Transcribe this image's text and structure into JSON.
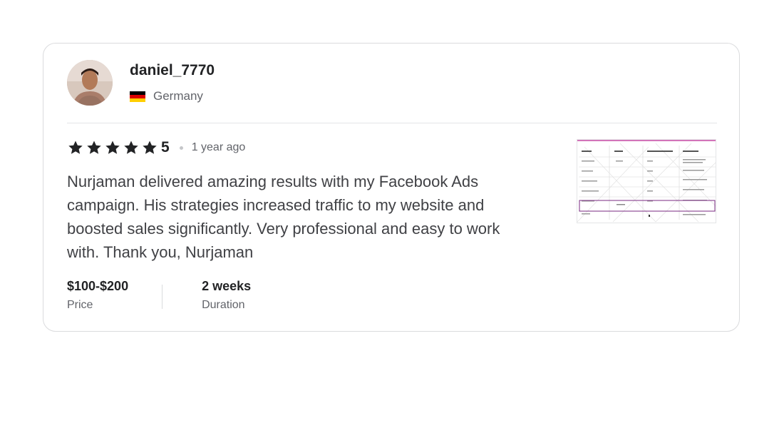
{
  "review": {
    "username": "daniel_7770",
    "country": "Germany",
    "rating": "5",
    "time_ago": "1 year ago",
    "text": "Nurjaman delivered amazing results with my Facebook Ads campaign. His strategies increased traffic to my website and boosted sales significantly. Very professional and easy to work with. Thank you, Nurjaman",
    "price_value": "$100-$200",
    "price_label": "Price",
    "duration_value": "2 weeks",
    "duration_label": "Duration",
    "star_count": 5
  },
  "colors": {
    "star": "#222325",
    "text": "#404145",
    "muted": "#62646a",
    "border": "#dadbdd",
    "thumb_accent": "#c0399b",
    "flag_black": "#000000",
    "flag_red": "#dd0000",
    "flag_gold": "#ffce00"
  },
  "icons": {
    "star": "star-icon",
    "flag": "germany-flag-icon",
    "avatar": "user-avatar"
  }
}
